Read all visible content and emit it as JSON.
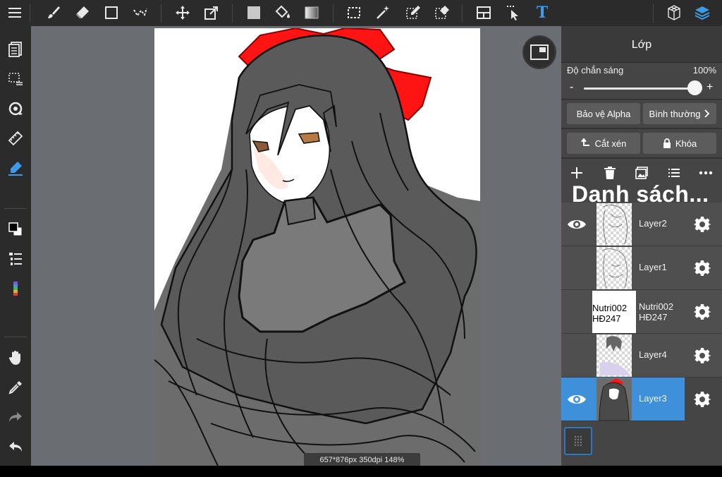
{
  "toolbar": {
    "icons": [
      "menu-icon",
      "brush-icon",
      "eraser-icon",
      "shape-icon",
      "lasso-icon",
      "move-icon",
      "transform-icon",
      "fill-color-icon",
      "bucket-icon",
      "gradient-icon",
      "select-rect-icon",
      "magic-wand-icon",
      "select-pen-icon",
      "select-eraser-icon",
      "layout-icon",
      "select-layer-icon",
      "text-icon",
      "3d-icon",
      "layers-icon"
    ],
    "text_tool_label": "T"
  },
  "sidebar": {
    "icons": [
      "pages-icon",
      "selection-icon",
      "rotate-icon",
      "ruler-icon",
      "pen-fill-icon",
      "color-swatch-icon",
      "layer-list-icon",
      "color-palette-icon",
      "hand-icon",
      "eyedropper-icon",
      "redo-icon",
      "undo-icon"
    ]
  },
  "canvas": {
    "status": "657*876px 350dpi 148%"
  },
  "layers_panel": {
    "title": "Lớp",
    "opacity_label": "Độ chắn sáng",
    "opacity_value": "100%",
    "opacity": 1.0,
    "minus": "-",
    "plus": "+",
    "alpha_protect": "Bảo vệ Alpha",
    "blend_mode": "Bình thường",
    "clipping": "Cắt xén",
    "lock": "Khóa",
    "list_title": "Danh sách...",
    "layers": [
      {
        "name": "Layer2",
        "visible": true,
        "selected": false
      },
      {
        "name": "Layer1",
        "visible": false,
        "selected": false
      },
      {
        "name": "Nutri002 HĐ247",
        "thumb_text": "Nutri002 HĐ247",
        "visible": false,
        "selected": false
      },
      {
        "name": "Layer4",
        "visible": false,
        "selected": false
      },
      {
        "name": "Layer3",
        "visible": true,
        "selected": true
      }
    ]
  },
  "colors": {
    "accent": "#3d90d9",
    "panel": "#454545",
    "toolbar": "#2b2b2b",
    "canvas_bg": "#6a6d72",
    "bow_red": "#ff1414",
    "hair_gray": "#555555"
  }
}
